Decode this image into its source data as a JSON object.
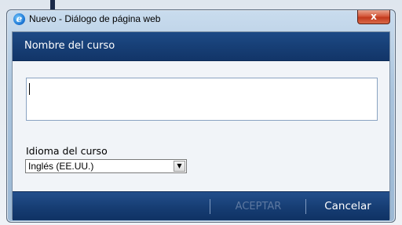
{
  "window": {
    "title": "Nuevo - Diálogo de página web",
    "close_glyph": "x",
    "app_icon": "ie-icon"
  },
  "dialog": {
    "header": "Nombre del curso",
    "name_input": {
      "value": "",
      "placeholder": ""
    },
    "language_label": "Idioma del curso",
    "language_select": {
      "value": "Inglés (EE.UU.)"
    }
  },
  "footer": {
    "accept_label": "ACEPTAR",
    "cancel_label": "Cancelar"
  },
  "colors": {
    "header_bg": "#1d4a86",
    "footer_bg": "#163d73",
    "accept_disabled": "#5d78a0",
    "close_button": "#c23a1d"
  }
}
